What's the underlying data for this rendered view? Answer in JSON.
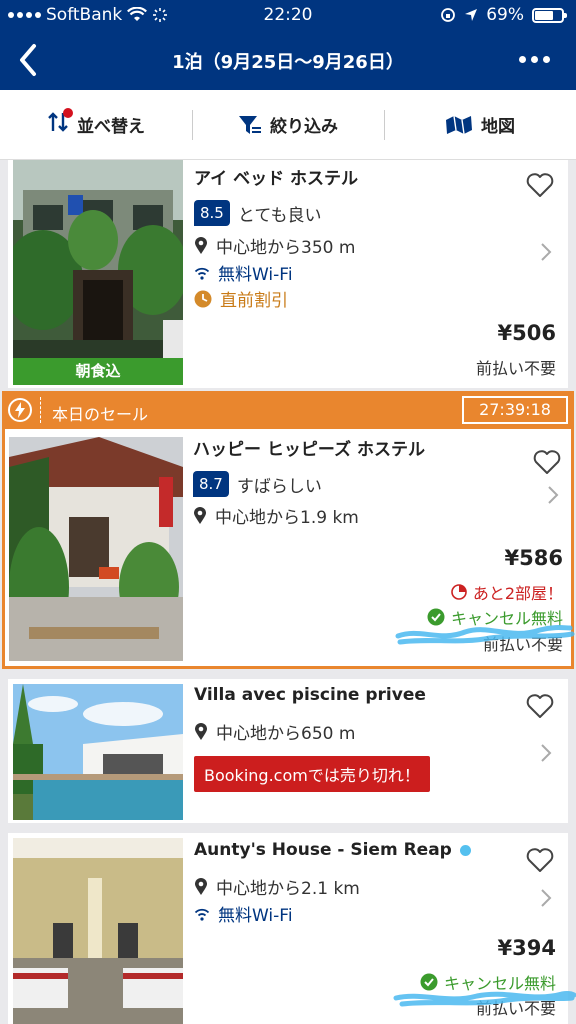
{
  "status_bar": {
    "carrier": "SoftBank",
    "time": "22:20",
    "battery": "69%"
  },
  "nav": {
    "title": "1泊（9月25日〜9月26日）"
  },
  "toolbar": {
    "sort_label": "並べ替え",
    "filter_label": "絞り込み",
    "map_label": "地図"
  },
  "sale": {
    "label": "本日のセール",
    "timer": "27:39:18"
  },
  "properties": [
    {
      "name": "アイ ベッド ホステル",
      "score": "8.5",
      "score_text": "とても良い",
      "distance": "中心地から350 m",
      "wifi": "無料Wi-Fi",
      "deal": "直前割引",
      "breakfast": "朝食込",
      "price": "¥506",
      "prepay": "前払い不要"
    },
    {
      "name": "ハッピー ヒッピーズ ホステル",
      "score": "8.7",
      "score_text": "すばらしい",
      "distance": "中心地から1.9 km",
      "price": "¥586",
      "rooms_left": "あと2部屋！",
      "cancel": "キャンセル無料",
      "prepay": "前払い不要"
    },
    {
      "name": "Villa avec piscine privee",
      "distance": "中心地から650 m",
      "soldout": "Booking.comでは売り切れ！"
    },
    {
      "name": "Aunty's House - Siem Reap",
      "distance": "中心地から2.1 km",
      "wifi": "無料Wi-Fi",
      "price": "¥394",
      "cancel": "キャンセル無料",
      "prepay": "前払い不要"
    }
  ],
  "colors": {
    "brand": "#003580",
    "sale": "#e9862e",
    "green": "#3b9b2d",
    "soldout": "#cc1e1e",
    "deal": "#c97b18"
  }
}
